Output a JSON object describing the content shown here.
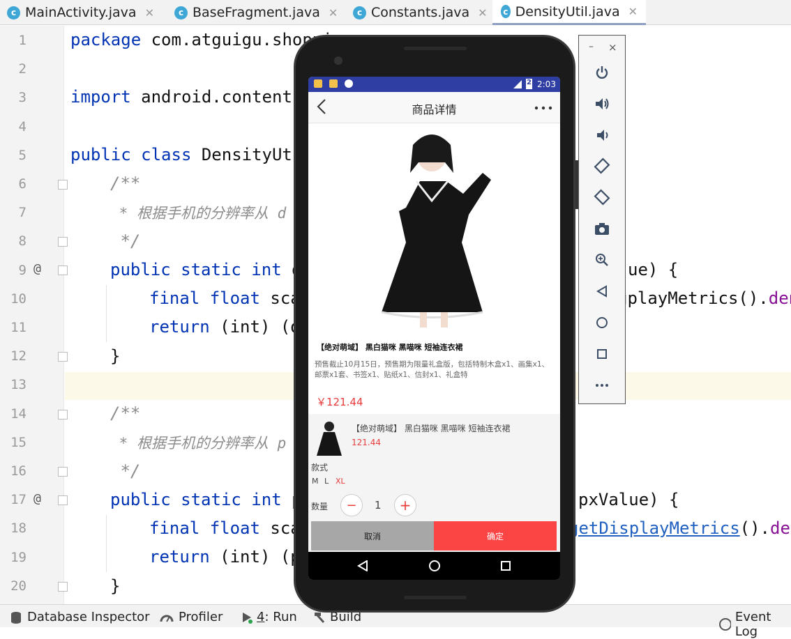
{
  "tabs": [
    {
      "name": "MainActivity.java",
      "icon": "class-icon"
    },
    {
      "name": "BaseFragment.java",
      "icon": "class-icon"
    },
    {
      "name": "Constants.java",
      "icon": "class-icon"
    },
    {
      "name": "DensityUtil.java",
      "icon": "class-icon"
    }
  ],
  "editor": {
    "line_numbers": [
      "1",
      "2",
      "3",
      "4",
      "5",
      "6",
      "7",
      "8",
      "9",
      "10",
      "11",
      "12",
      "13",
      "14",
      "15",
      "16",
      "17",
      "18",
      "19",
      "20"
    ],
    "code": {
      "l1a": "package",
      "l1b": " com.atguigu.shoppi",
      "l3a": "import",
      "l3b": " android.content.",
      "l5a": "public class",
      "l5b": " DensityUti",
      "l6": "/**",
      "l7a": " * 根据手机的分辨率从 ",
      "l7b": "d",
      "l8": " */",
      "l9a": "public static int",
      "l9b": " d",
      "l9c": "ue) {",
      "l10a": "final float",
      "l10b": " sca",
      "l10c": "g",
      "l10d": "playMetrics().",
      "l10e": "den",
      "l11a": "return",
      "l11b": " (int) (d",
      "l12": "}",
      "l14": "/**",
      "l15a": " * 根据手机的分辨率从 ",
      "l15b": "p",
      "l16": " */",
      "l17a": "public static int",
      "l17b": " p",
      "l17c": "pxValue) {",
      "l18a": "final float",
      "l18b": " sca",
      "l18c": "getDisplayMetrics",
      "l18d": "().",
      "l18e": "den",
      "l19a": "return",
      "l19b": " (int) (p",
      "l20": "}",
      "override": "@"
    }
  },
  "bottom_bar": {
    "database": "Database Inspector",
    "profiler": "Profiler",
    "run_num": "4",
    "run": ": Run",
    "build": "Build",
    "event": "Event Log"
  },
  "emulator_panel": {
    "minimize": "–",
    "close": "×",
    "buttons": [
      "power-icon",
      "volume-up-icon",
      "volume-down-icon",
      "rotate-left-icon",
      "rotate-right-icon",
      "camera-icon",
      "zoom-icon",
      "back-icon",
      "home-icon",
      "overview-icon",
      "more-icon"
    ]
  },
  "phone": {
    "status": {
      "time": "2:03",
      "battery": "2"
    },
    "app_title": "商品详情",
    "product_title": "【绝对萌域】 黑白猫咪 黑喵咪 短袖连衣裙",
    "description": "预售截止10月15日，预售期为限量礼盒版，包括特制木盒x1、画集x1、邮票x1套、书签x1、贴纸x1、信封x1、礼盒特",
    "price": "￥121.44",
    "sheet": {
      "name": "【绝对萌域】 黑白猫咪 黑喵咪 短袖连衣裙",
      "price": "121.44",
      "style_label": "款式",
      "sizes": [
        "M",
        "L",
        "XL"
      ],
      "selected_size": "XL",
      "qty_label": "数量",
      "quantity": "1",
      "minus": "−",
      "plus": "+",
      "cancel": "取消",
      "confirm": "确定"
    },
    "accent": "#e83a3a"
  },
  "colors": {
    "keyword": "#0033b3",
    "comment": "#8c8c8c",
    "purple": "#871094",
    "status_bar": "#2f3ea3",
    "confirm": "#fb4545",
    "cancel": "#a7a7a7"
  }
}
